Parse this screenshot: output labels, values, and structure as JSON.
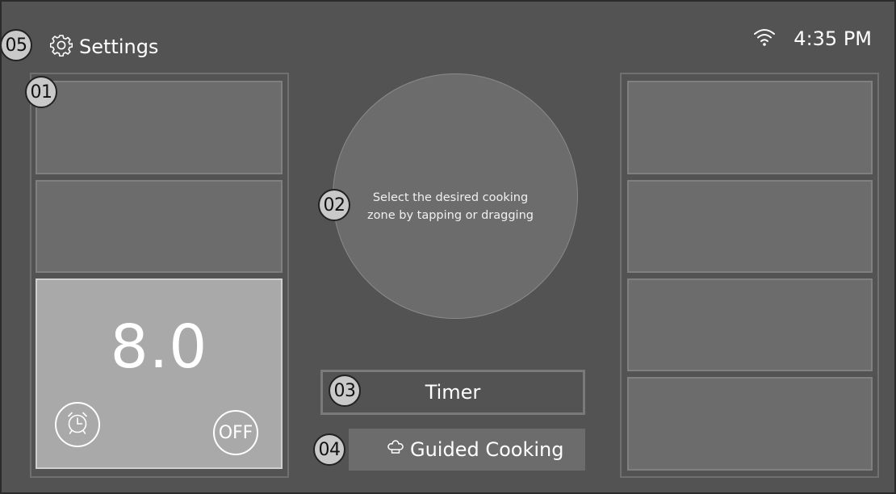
{
  "header": {
    "settings_label": "Settings",
    "settings_icon": "gear-icon",
    "wifi_icon": "wifi-icon",
    "time": "4:35 PM"
  },
  "left_panel": {
    "active_zone": {
      "power_level": "8.0",
      "timer_icon": "alarm-clock-icon",
      "off_label": "OFF"
    }
  },
  "center": {
    "zone_hint": "Select the desired cooking zone by tapping or dragging",
    "timer_label": "Timer",
    "guided_label": "Guided Cooking",
    "guided_icon": "chef-hat-icon"
  },
  "markers": {
    "m01": "01",
    "m02": "02",
    "m03": "03",
    "m04": "04",
    "m05": "05"
  },
  "colors": {
    "background": "#535353",
    "tile": "#6c6c6d",
    "active_tile": "#a9a9a9",
    "text": "#ffffff"
  }
}
